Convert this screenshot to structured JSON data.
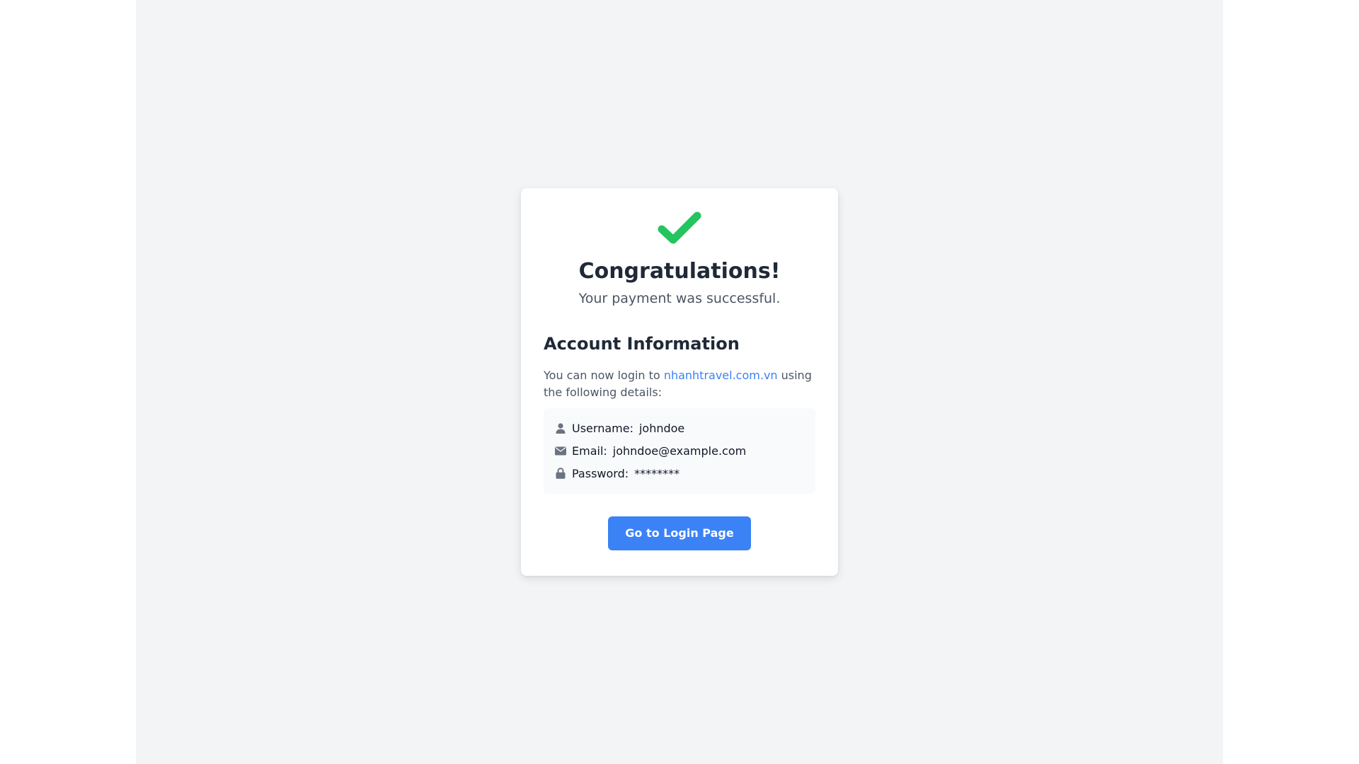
{
  "success": {
    "icon": "check-icon",
    "icon_color": "#22c55e",
    "title": "Congratulations!",
    "subtitle": "Your payment was successful."
  },
  "account": {
    "heading": "Account Information",
    "intro_prefix": "You can now login to ",
    "site_link": "nhanhtravel.com.vn",
    "intro_suffix": " using the following details:",
    "details": {
      "username": {
        "icon": "user-icon",
        "label": "Username:",
        "value": "johndoe"
      },
      "email": {
        "icon": "envelope-icon",
        "label": "Email:",
        "value": "johndoe@example.com"
      },
      "password": {
        "icon": "lock-icon",
        "label": "Password:",
        "value": "********"
      }
    }
  },
  "actions": {
    "login_button": "Go to Login Page"
  },
  "colors": {
    "accent": "#3b82f6",
    "success": "#22c55e",
    "page_background": "#f3f4f6"
  }
}
